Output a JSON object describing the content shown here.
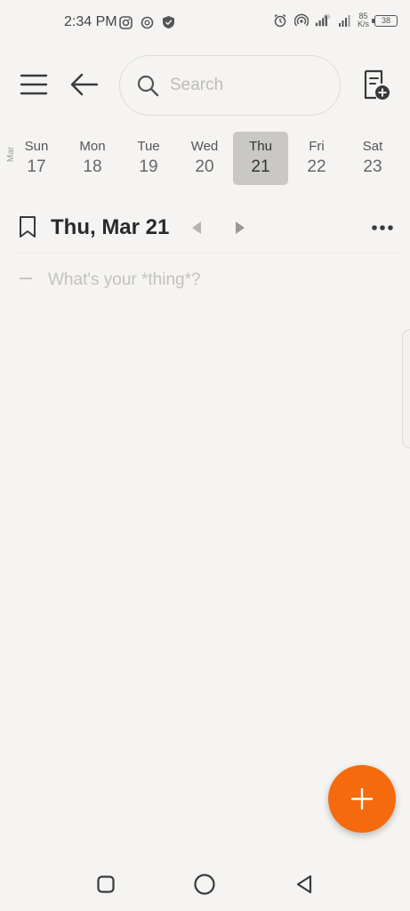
{
  "status_bar": {
    "time": "2:34 PM",
    "net_speed_value": "85",
    "net_speed_unit": "K/s",
    "network_type": "4G",
    "battery": "38"
  },
  "toolbar": {
    "search_placeholder": "Search"
  },
  "week": {
    "month": "Mar",
    "days": [
      {
        "name": "Sun",
        "num": "17"
      },
      {
        "name": "Mon",
        "num": "18"
      },
      {
        "name": "Tue",
        "num": "19"
      },
      {
        "name": "Wed",
        "num": "20"
      },
      {
        "name": "Thu",
        "num": "21"
      },
      {
        "name": "Fri",
        "num": "22"
      },
      {
        "name": "Sat",
        "num": "23"
      }
    ],
    "selected_day": "Thu"
  },
  "date_header": {
    "title": "Thu, Mar 21"
  },
  "entry": {
    "placeholder": "What's your *thing*?"
  },
  "colors": {
    "accent": "#f46a0c",
    "background": "#f5f4f2",
    "selected_day": "#c9c8c4"
  }
}
